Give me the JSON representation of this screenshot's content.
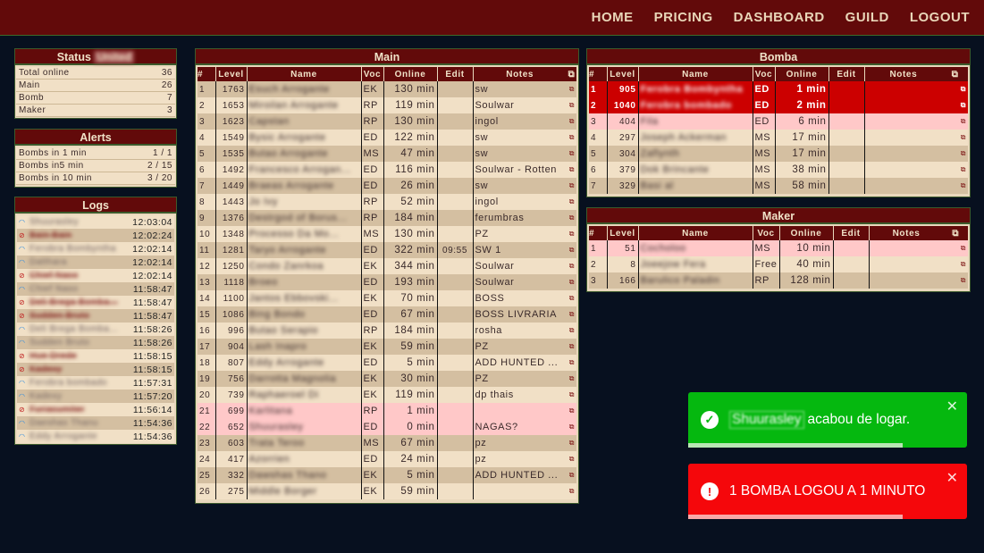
{
  "nav": [
    "HOME",
    "PRICING",
    "DASHBOARD",
    "GUILD",
    "LOGOUT"
  ],
  "status": {
    "title": "Status",
    "guild": "United",
    "rows": [
      [
        "Total online",
        "36"
      ],
      [
        "Main",
        "26"
      ],
      [
        "Bomb",
        "7"
      ],
      [
        "Maker",
        "3"
      ]
    ]
  },
  "alerts": {
    "title": "Alerts",
    "rows": [
      [
        "Bombs in 1 min",
        "1 / 1"
      ],
      [
        "Bombs in5 min",
        "2 / 15"
      ],
      [
        "Bombs in 10 min",
        "3 / 20"
      ]
    ]
  },
  "logs": {
    "title": "Logs",
    "rows": [
      {
        "name": "Shuurasley",
        "time": "12:03:04",
        "online": true
      },
      {
        "name": "Bain Bain",
        "time": "12:02:24",
        "online": false
      },
      {
        "name": "Ferobra Bombyntha",
        "time": "12:02:14",
        "online": true
      },
      {
        "name": "Dalthara",
        "time": "12:02:14",
        "online": true
      },
      {
        "name": "Chief Naso",
        "time": "12:02:14",
        "online": false
      },
      {
        "name": "Chief Naso",
        "time": "11:58:47",
        "online": true
      },
      {
        "name": "Deli Brega Bomba...",
        "time": "11:58:47",
        "online": false
      },
      {
        "name": "Sudden Bruto",
        "time": "11:58:47",
        "online": false
      },
      {
        "name": "Deli Brega Bomba...",
        "time": "11:58:26",
        "online": true
      },
      {
        "name": "Sudden Bruto",
        "time": "11:58:26",
        "online": true
      },
      {
        "name": "Hue Drede",
        "time": "11:58:15",
        "online": false
      },
      {
        "name": "Kadexy",
        "time": "11:58:15",
        "online": false
      },
      {
        "name": "Ferobra bombado",
        "time": "11:57:31",
        "online": true
      },
      {
        "name": "Kadexy",
        "time": "11:57:20",
        "online": true
      },
      {
        "name": "Furiasumiter",
        "time": "11:56:14",
        "online": false
      },
      {
        "name": "Daeshas Thanu",
        "time": "11:54:36",
        "online": true
      },
      {
        "name": "Eddy Arrogante",
        "time": "11:54:36",
        "online": true
      }
    ]
  },
  "columns": [
    "#",
    "Level",
    "Name",
    "Voc",
    "Online",
    "Edit",
    "Notes"
  ],
  "note_icon": "⧉",
  "main": {
    "title": "Main",
    "rows": [
      [
        "1",
        "1763",
        "Esuch Arrogante",
        "EK",
        "130 min",
        "",
        "sw",
        ""
      ],
      [
        "2",
        "1653",
        "Miroilan Arrogante",
        "RP",
        "119 min",
        "",
        "Soulwar",
        ""
      ],
      [
        "3",
        "1623",
        "Capstan",
        "RP",
        "130 min",
        "",
        "ingol",
        ""
      ],
      [
        "4",
        "1549",
        "Bysic Arrogante",
        "ED",
        "122 min",
        "",
        "sw",
        ""
      ],
      [
        "5",
        "1535",
        "Butao Arrogante",
        "MS",
        "47 min",
        "",
        "sw",
        ""
      ],
      [
        "6",
        "1492",
        "Francesco Arrogan...",
        "ED",
        "116 min",
        "",
        "Soulwar - Rotten",
        ""
      ],
      [
        "7",
        "1449",
        "Braeas Arrogante",
        "ED",
        "26 min",
        "",
        "sw",
        ""
      ],
      [
        "8",
        "1443",
        "Jo Ivy",
        "RP",
        "52 min",
        "",
        "ingol",
        ""
      ],
      [
        "9",
        "1376",
        "Destrgod of Borus...",
        "RP",
        "184 min",
        "",
        "ferumbras",
        ""
      ],
      [
        "10",
        "1348",
        "Processo Da Mo...",
        "MS",
        "130 min",
        "",
        "PZ",
        ""
      ],
      [
        "11",
        "1281",
        "Taryo Arrogante",
        "ED",
        "322 min",
        "09:55",
        "SW 1",
        ""
      ],
      [
        "12",
        "1250",
        "Condo Zanrkoa",
        "EK",
        "344 min",
        "",
        "Soulwar",
        ""
      ],
      [
        "13",
        "1118",
        "Broeo",
        "ED",
        "193 min",
        "",
        "Soulwar",
        ""
      ],
      [
        "14",
        "1100",
        "Jantos Ebbovski...",
        "EK",
        "70 min",
        "",
        "BOSS",
        ""
      ],
      [
        "15",
        "1086",
        "Bing Bondo",
        "ED",
        "67 min",
        "",
        "BOSS LIVRARIA",
        ""
      ],
      [
        "16",
        "996",
        "Butao Serapio",
        "RP",
        "184 min",
        "",
        "rosha",
        ""
      ],
      [
        "17",
        "904",
        "Lash Inapro",
        "EK",
        "59 min",
        "",
        "PZ",
        ""
      ],
      [
        "18",
        "807",
        "Eddy Arrogante",
        "ED",
        "5 min",
        "",
        "ADD HUNTED ...",
        ""
      ],
      [
        "19",
        "756",
        "Darrotta Magnolia",
        "EK",
        "30 min",
        "",
        "PZ",
        ""
      ],
      [
        "20",
        "739",
        "Raphaeroel Di",
        "EK",
        "119 min",
        "",
        "dp thais",
        ""
      ],
      [
        "21",
        "699",
        "Karlitana",
        "RP",
        "1 min",
        "",
        "",
        "pink"
      ],
      [
        "22",
        "652",
        "Shuurasley",
        "ED",
        "0 min",
        "",
        "NAGAS?",
        "pink"
      ],
      [
        "23",
        "603",
        "Trata Teroo",
        "MS",
        "67 min",
        "",
        "pz",
        ""
      ],
      [
        "24",
        "417",
        "Azorrien",
        "ED",
        "24 min",
        "",
        "pz",
        ""
      ],
      [
        "25",
        "332",
        "Dawshas Thano",
        "EK",
        "5 min",
        "",
        "ADD HUNTED ...",
        ""
      ],
      [
        "26",
        "275",
        "Middle Borger",
        "EK",
        "59 min",
        "",
        "",
        ""
      ]
    ]
  },
  "bomba": {
    "title": "Bomba",
    "rows": [
      [
        "1",
        "905",
        "Ferobra Bombyntha",
        "ED",
        "1 min",
        "",
        "",
        "red"
      ],
      [
        "2",
        "1040",
        "Ferobra bombado",
        "ED",
        "2 min",
        "",
        "",
        "red"
      ],
      [
        "3",
        "404",
        "Fila",
        "ED",
        "6 min",
        "",
        "",
        "pink"
      ],
      [
        "4",
        "297",
        "Joseph Ackerman",
        "MS",
        "17 min",
        "",
        "",
        ""
      ],
      [
        "5",
        "304",
        "Zaflynth",
        "MS",
        "17 min",
        "",
        "",
        ""
      ],
      [
        "6",
        "379",
        "Dok Brincante",
        "MS",
        "38 min",
        "",
        "",
        ""
      ],
      [
        "7",
        "329",
        "Basi al",
        "MS",
        "58 min",
        "",
        "",
        ""
      ]
    ]
  },
  "maker": {
    "title": "Maker",
    "rows": [
      [
        "1",
        "51",
        "Cocholoo",
        "MS",
        "10 min",
        "",
        "",
        "pink"
      ],
      [
        "2",
        "8",
        "Joeejow Fera",
        "Free",
        "40 min",
        "",
        "",
        ""
      ],
      [
        "3",
        "166",
        "Barulico Paladin",
        "RP",
        "128 min",
        "",
        "",
        ""
      ]
    ]
  },
  "toasts": [
    {
      "name": "Shuurasley",
      "text": "acabou de logar.",
      "color": "#05b80f",
      "bar": "#b8e6b4",
      "progress": 0.77,
      "icon": "✓"
    },
    {
      "text": "1 BOMBA LOGOU A 1 MINUTO",
      "color": "#f5070b",
      "bar": "#f8a7a7",
      "progress": 0.77,
      "icon": "!"
    }
  ],
  "close_icon": "✕"
}
